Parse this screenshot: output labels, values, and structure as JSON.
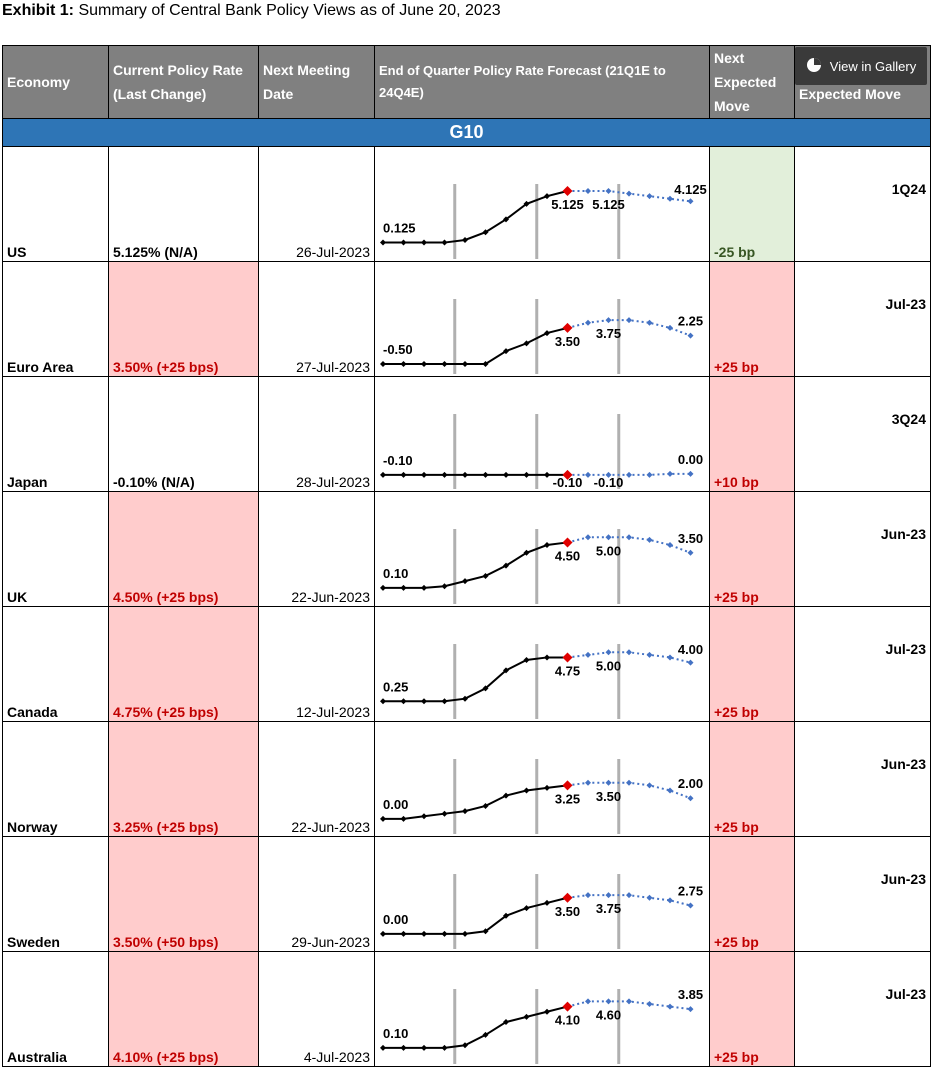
{
  "exhibit": {
    "label": "Exhibit 1:",
    "text": "Summary of Central Bank Policy Views as of June 20, 2023"
  },
  "gallery_button": "View in Gallery",
  "headers": {
    "economy": "Economy",
    "current_rate": "Current Policy Rate (Last Change)",
    "next_meeting": "Next Meeting Date",
    "forecast": "End of Quarter Policy Rate Forecast (21Q1E to 24Q4E)",
    "next_move": "Next Expected Move",
    "timing": "Timing of Next Expected Move"
  },
  "group": "G10",
  "rows": [
    {
      "economy": "US",
      "rate": "5.125% (N/A)",
      "rate_highlight": false,
      "meeting": "26-Jul-2023",
      "move": "-25 bp",
      "move_dir": "down",
      "timing": "1Q24",
      "labels": [
        "0.125",
        "5.125",
        "5.125",
        "4.125"
      ],
      "series": [
        0.125,
        0.125,
        0.125,
        0.125,
        0.375,
        1.125,
        2.375,
        3.875,
        4.625,
        5.125,
        5.125,
        5.125,
        4.875,
        4.625,
        4.375,
        4.125
      ]
    },
    {
      "economy": "Euro Area",
      "rate": "3.50% (+25 bps)",
      "rate_highlight": true,
      "meeting": "27-Jul-2023",
      "move": "+25 bp",
      "move_dir": "up",
      "timing": "Jul-23",
      "labels": [
        "-0.50",
        "3.50",
        "3.75",
        "2.25"
      ],
      "series": [
        -0.5,
        -0.5,
        -0.5,
        -0.5,
        -0.5,
        -0.5,
        0.75,
        1.5,
        2.5,
        3.0,
        3.5,
        3.75,
        3.75,
        3.5,
        3.0,
        2.25
      ]
    },
    {
      "economy": "Japan",
      "rate": "-0.10% (N/A)",
      "rate_highlight": false,
      "meeting": "28-Jul-2023",
      "move": "+10 bp",
      "move_dir": "up",
      "timing": "3Q24",
      "labels": [
        "-0.10",
        "-0.10",
        "-0.10",
        "0.00"
      ],
      "series": [
        -0.1,
        -0.1,
        -0.1,
        -0.1,
        -0.1,
        -0.1,
        -0.1,
        -0.1,
        -0.1,
        -0.1,
        -0.1,
        -0.1,
        -0.1,
        -0.1,
        0.0,
        0.0
      ]
    },
    {
      "economy": "UK",
      "rate": "4.50% (+25 bps)",
      "rate_highlight": true,
      "meeting": "22-Jun-2023",
      "move": "+25 bp",
      "move_dir": "up",
      "timing": "Jun-23",
      "labels": [
        "0.10",
        "4.50",
        "5.00",
        "3.50"
      ],
      "series": [
        0.1,
        0.1,
        0.1,
        0.25,
        0.75,
        1.25,
        2.25,
        3.5,
        4.25,
        4.5,
        5.0,
        5.0,
        5.0,
        4.75,
        4.25,
        3.5
      ]
    },
    {
      "economy": "Canada",
      "rate": "4.75% (+25 bps)",
      "rate_highlight": true,
      "meeting": "12-Jul-2023",
      "move": "+25 bp",
      "move_dir": "up",
      "timing": "Jul-23",
      "labels": [
        "0.25",
        "4.75",
        "5.00",
        "4.00"
      ],
      "series": [
        0.25,
        0.25,
        0.25,
        0.25,
        0.5,
        1.5,
        3.25,
        4.25,
        4.5,
        4.5,
        4.75,
        5.0,
        5.0,
        4.75,
        4.5,
        4.0
      ]
    },
    {
      "economy": "Norway",
      "rate": "3.25% (+25 bps)",
      "rate_highlight": true,
      "meeting": "22-Jun-2023",
      "move": "+25 bp",
      "move_dir": "up",
      "timing": "Jun-23",
      "labels": [
        "0.00",
        "3.25",
        "3.50",
        "2.00"
      ],
      "series": [
        0.0,
        0.0,
        0.25,
        0.5,
        0.75,
        1.25,
        2.25,
        2.75,
        3.0,
        3.25,
        3.5,
        3.5,
        3.5,
        3.25,
        2.75,
        2.0
      ]
    },
    {
      "economy": "Sweden",
      "rate": "3.50% (+50 bps)",
      "rate_highlight": true,
      "meeting": "29-Jun-2023",
      "move": "+25 bp",
      "move_dir": "up",
      "timing": "Jun-23",
      "labels": [
        "0.00",
        "3.50",
        "3.75",
        "2.75"
      ],
      "series": [
        0.0,
        0.0,
        0.0,
        0.0,
        0.0,
        0.25,
        1.75,
        2.5,
        3.0,
        3.5,
        3.75,
        3.75,
        3.75,
        3.5,
        3.25,
        2.75
      ]
    },
    {
      "economy": "Australia",
      "rate": "4.10% (+25 bps)",
      "rate_highlight": true,
      "meeting": "4-Jul-2023",
      "move": "+25 bp",
      "move_dir": "up",
      "timing": "Jul-23",
      "labels": [
        "0.10",
        "4.10",
        "4.60",
        "3.85"
      ],
      "series": [
        0.1,
        0.1,
        0.1,
        0.1,
        0.35,
        1.35,
        2.6,
        3.1,
        3.6,
        4.1,
        4.6,
        4.6,
        4.6,
        4.35,
        4.1,
        3.85
      ]
    }
  ]
}
